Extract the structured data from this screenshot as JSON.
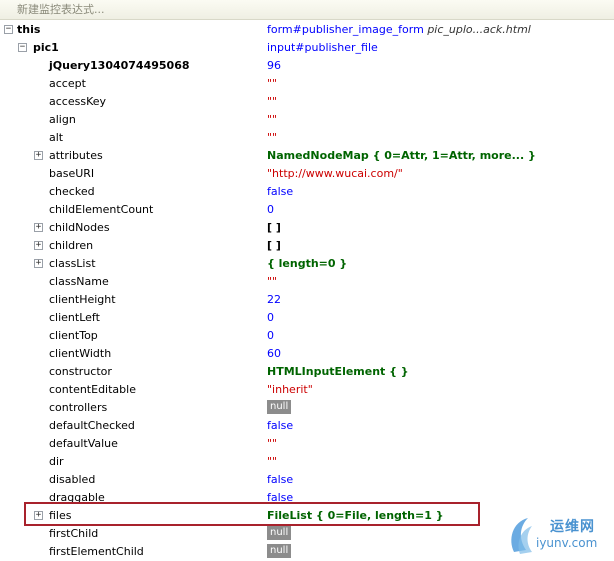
{
  "watch": {
    "placeholder": "新建监控表达式..."
  },
  "colors": {
    "string": "#cc0000",
    "number": "#0000ff",
    "object": "#006400",
    "highlight_border": "#a8222c"
  },
  "rows": [
    {
      "name": "this",
      "value": "form#publisher_image_form",
      "value_extra": "pic_uplo...ack.html",
      "toggle": "−",
      "kind": "blue"
    },
    {
      "name": "pic1",
      "value": "input#publisher_file",
      "toggle": "−",
      "kind": "blue"
    },
    {
      "name": "jQuery1304074495068",
      "value": "96",
      "kind": "blue"
    },
    {
      "name": "accept",
      "value": "\"\"",
      "kind": "red"
    },
    {
      "name": "accessKey",
      "value": "\"\"",
      "kind": "red"
    },
    {
      "name": "align",
      "value": "\"\"",
      "kind": "red"
    },
    {
      "name": "alt",
      "value": "\"\"",
      "kind": "red"
    },
    {
      "name": "attributes",
      "value": "NamedNodeMap { 0=Attr, 1=Attr, more... }",
      "toggle": "+",
      "kind": "green"
    },
    {
      "name": "baseURI",
      "value": "\"http://www.wucai.com/\"",
      "kind": "red"
    },
    {
      "name": "checked",
      "value": "false",
      "kind": "blue"
    },
    {
      "name": "childElementCount",
      "value": "0",
      "kind": "blue"
    },
    {
      "name": "childNodes",
      "value": "[ ]",
      "toggle": "+",
      "kind": "black"
    },
    {
      "name": "children",
      "value": "[ ]",
      "toggle": "+",
      "kind": "black"
    },
    {
      "name": "classList",
      "value": "{ length=0 }",
      "toggle": "+",
      "kind": "green"
    },
    {
      "name": "className",
      "value": "\"\"",
      "kind": "red"
    },
    {
      "name": "clientHeight",
      "value": "22",
      "kind": "blue"
    },
    {
      "name": "clientLeft",
      "value": "0",
      "kind": "blue"
    },
    {
      "name": "clientTop",
      "value": "0",
      "kind": "blue"
    },
    {
      "name": "clientWidth",
      "value": "60",
      "kind": "blue"
    },
    {
      "name": "constructor",
      "value": "HTMLInputElement { }",
      "kind": "green"
    },
    {
      "name": "contentEditable",
      "value": "\"inherit\"",
      "kind": "red"
    },
    {
      "name": "controllers",
      "value": "null",
      "kind": "null"
    },
    {
      "name": "defaultChecked",
      "value": "false",
      "kind": "blue"
    },
    {
      "name": "defaultValue",
      "value": "\"\"",
      "kind": "red"
    },
    {
      "name": "dir",
      "value": "\"\"",
      "kind": "red"
    },
    {
      "name": "disabled",
      "value": "false",
      "kind": "blue"
    },
    {
      "name": "draggable",
      "value": "false",
      "kind": "blue"
    },
    {
      "name": "files",
      "value": "FileList { 0=File, length=1 }",
      "toggle": "+",
      "kind": "green"
    },
    {
      "name": "firstChild",
      "value": "null",
      "kind": "null"
    },
    {
      "name": "firstElementChild",
      "value": "null",
      "kind": "null"
    }
  ],
  "watermark": {
    "line1": "运维网",
    "line2": "iyunv.com"
  }
}
